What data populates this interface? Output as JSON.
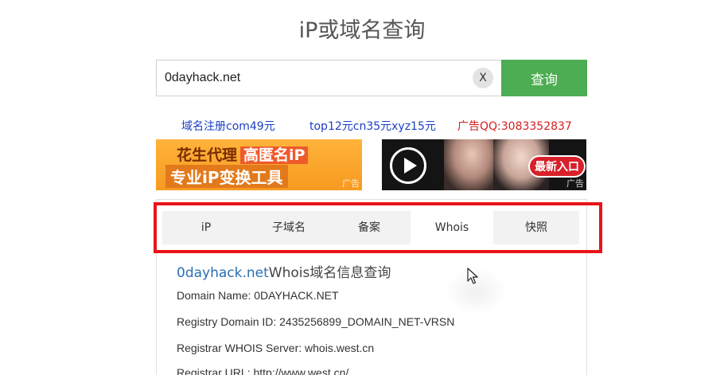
{
  "page": {
    "title": "iP或域名查询"
  },
  "search": {
    "value": "0dayhack.net",
    "clear_label": "X",
    "button_label": "查询"
  },
  "ad_links": [
    {
      "text": "域名注册com49元",
      "color": "#1c3fc4"
    },
    {
      "text": "top12元cn35元xyz15元",
      "color": "#1c3fc4"
    },
    {
      "text": "广告QQ:3083352837",
      "color": "#d81e1e"
    }
  ],
  "banners": {
    "left": {
      "line1_a": "花生代理",
      "line1_b": "高匿名iP",
      "line2": "专业iP变换工具",
      "tag": "广告"
    },
    "right": {
      "button": "最新入口",
      "tag": "广告",
      "icon": "play-icon"
    }
  },
  "tabs": [
    {
      "label": "iP",
      "active": false
    },
    {
      "label": "子域名",
      "active": false
    },
    {
      "label": "备案",
      "active": false
    },
    {
      "label": "Whois",
      "active": true
    },
    {
      "label": "快照",
      "active": false
    }
  ],
  "whois": {
    "domain": "0dayhack.net",
    "title_suffix": "Whois域名信息查询",
    "lines": [
      "Domain Name: 0DAYHACK.NET",
      "Registry Domain ID: 2435256899_DOMAIN_NET-VRSN",
      "Registrar WHOIS Server: whois.west.cn",
      "Registrar URL: http://www.west.cn/"
    ]
  },
  "colors": {
    "accent_green": "#4cad52",
    "highlight_red": "#e8141a",
    "link_blue": "#1c3fc4"
  }
}
